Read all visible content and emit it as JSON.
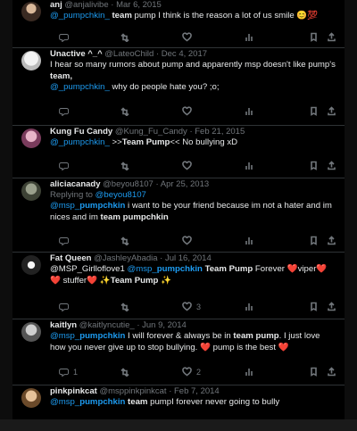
{
  "tweets": [
    {
      "name": "anj",
      "handle": "@anjalivibe",
      "date": "· Mar 6, 2015",
      "reply_text": "",
      "parts": [
        {
          "t": "@_pumpchkin_",
          "c": "mention"
        },
        {
          "t": " team",
          "c": "strong"
        },
        {
          "t": " pump I think is the reason a lot of us smile ",
          "c": ""
        },
        {
          "t": "😊💯",
          "c": ""
        }
      ],
      "replies": "",
      "retweets": "",
      "likes": ""
    },
    {
      "name": "Unactive ^_^",
      "handle": "@LateoChild",
      "date": "· Dec 4, 2017",
      "reply_text": "",
      "parts": [
        {
          "t": "I hear so many rumors about pump and apparently msp doesn't like pump's ",
          "c": ""
        },
        {
          "t": "team,",
          "c": "strong"
        },
        {
          "t": "\n",
          "c": ""
        },
        {
          "t": "@_pumpchkin_",
          "c": "mention"
        },
        {
          "t": " why do people hate you? ;o;",
          "c": ""
        }
      ],
      "replies": "",
      "retweets": "",
      "likes": ""
    },
    {
      "name": "Kung Fu Candy",
      "handle": "@Kung_Fu_Candy",
      "date": "· Feb 21, 2015",
      "reply_text": "",
      "parts": [
        {
          "t": "@_pumpchkin_",
          "c": "mention"
        },
        {
          "t": " >>",
          "c": ""
        },
        {
          "t": "Team Pump",
          "c": "strong"
        },
        {
          "t": "<< No bullying xD",
          "c": ""
        }
      ],
      "replies": "",
      "retweets": "",
      "likes": ""
    },
    {
      "name": "aliciacanady",
      "handle": "@beyou8107",
      "date": "· Apr 25, 2013",
      "reply_text": "Replying to ",
      "reply_mention": "@beyou8107",
      "parts": [
        {
          "t": "@msp_",
          "c": "mention"
        },
        {
          "t": "pumpchkin",
          "c": "mention strong"
        },
        {
          "t": " i want to be your friend because im not a hater  and im nices and im ",
          "c": ""
        },
        {
          "t": "team pumpchkin",
          "c": "strong"
        }
      ],
      "replies": "",
      "retweets": "",
      "likes": ""
    },
    {
      "name": "Fat Queen",
      "handle": "@JashleyAbadia",
      "date": "· Jul 16, 2014",
      "reply_text": "",
      "parts": [
        {
          "t": "@MSP_Girlloflove1 ",
          "c": ""
        },
        {
          "t": "@msp_",
          "c": "mention"
        },
        {
          "t": "pumpchkin",
          "c": "mention strong"
        },
        {
          "t": " Team Pump",
          "c": "strong"
        },
        {
          "t": " Forever ",
          "c": ""
        },
        {
          "t": "❤️",
          "c": "heart-e"
        },
        {
          "t": "viper",
          "c": ""
        },
        {
          "t": "❤️ ❤️",
          "c": "heart-e"
        },
        {
          "t": " stuffer",
          "c": ""
        },
        {
          "t": "❤️",
          "c": "heart-e"
        },
        {
          "t": " ✨",
          "c": ""
        },
        {
          "t": "Team Pump",
          "c": "strong"
        },
        {
          "t": " ✨",
          "c": ""
        }
      ],
      "replies": "",
      "retweets": "",
      "likes": "3"
    },
    {
      "name": "kaitlyn",
      "handle": "@kaitlyncutie_",
      "date": "· Jun 9, 2014",
      "reply_text": "",
      "parts": [
        {
          "t": "@msp_",
          "c": "mention"
        },
        {
          "t": "pumpchkin",
          "c": "mention strong"
        },
        {
          "t": " I will forever & always be in ",
          "c": ""
        },
        {
          "t": "team pump",
          "c": "strong"
        },
        {
          "t": ". I just love how you never give up to stop bullying. ",
          "c": ""
        },
        {
          "t": "❤️",
          "c": "heart-e"
        },
        {
          "t": " pump is the best ",
          "c": ""
        },
        {
          "t": "❤️",
          "c": "heart-e"
        }
      ],
      "replies": "1",
      "retweets": "",
      "likes": "2"
    },
    {
      "name": "pinkpinkcat",
      "handle": "@msppinkpinkcat",
      "date": "· Feb 7, 2014",
      "reply_text": "",
      "parts": [
        {
          "t": "@msp_",
          "c": "mention"
        },
        {
          "t": "pumpchkin",
          "c": "mention strong"
        },
        {
          "t": " team",
          "c": "strong"
        },
        {
          "t": " pumpI forever never going to bully",
          "c": ""
        }
      ],
      "replies": "",
      "retweets": "",
      "likes": ""
    }
  ],
  "icons": {
    "reply": "reply-icon",
    "retweet": "retweet-icon",
    "like": "heart-icon",
    "views": "views-icon",
    "bookmark": "bookmark-icon",
    "share": "share-icon"
  },
  "colors": {
    "mention": "#1d9bf0",
    "muted": "#71767b",
    "background": "#000000"
  }
}
